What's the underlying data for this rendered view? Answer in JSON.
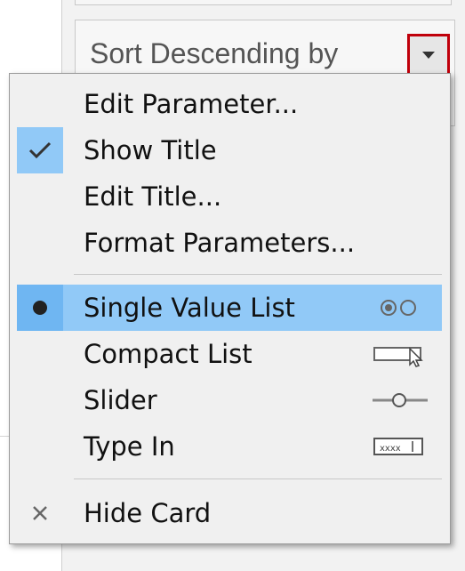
{
  "card": {
    "title": "Sort Descending by"
  },
  "menu": {
    "items": [
      {
        "label": "Edit Parameter..."
      },
      {
        "label": "Show Title",
        "checked": true
      },
      {
        "label": "Edit Title..."
      },
      {
        "label": "Format Parameters..."
      },
      {
        "label": "Single Value List",
        "selected": true,
        "icon": "radio-buttons-icon"
      },
      {
        "label": "Compact List",
        "icon": "dropdown-list-icon"
      },
      {
        "label": "Slider",
        "icon": "slider-icon"
      },
      {
        "label": "Type In",
        "icon": "text-input-icon"
      },
      {
        "label": "Hide Card",
        "icon": "close-icon"
      }
    ]
  },
  "colors": {
    "selection_highlight": "#91c9f7",
    "selection_gutter": "#6fb6f2",
    "annotation_border": "#c0000b"
  }
}
